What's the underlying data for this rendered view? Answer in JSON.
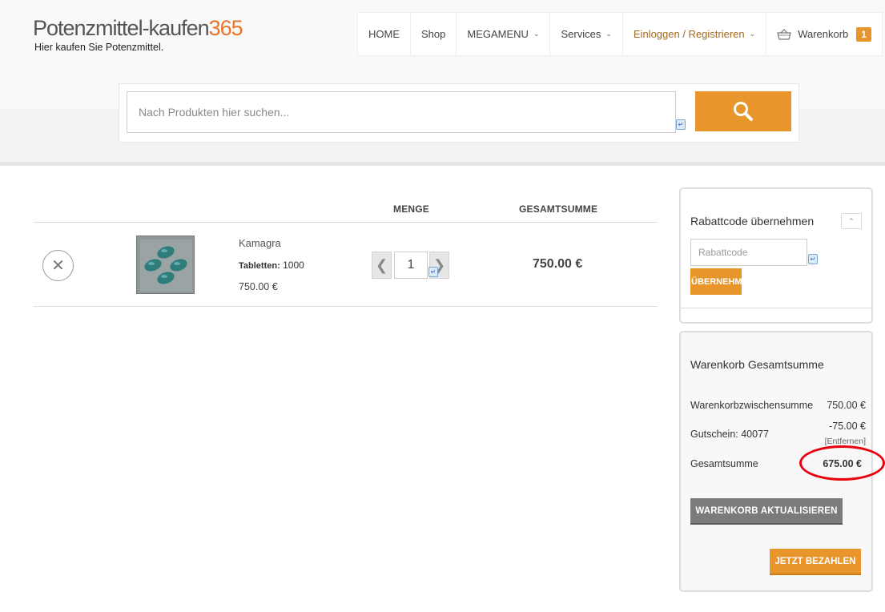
{
  "site": {
    "logo_text": "Potenzmittel-kaufen",
    "logo_number": "365",
    "tagline": "Hier kaufen Sie Potenzmittel."
  },
  "nav": {
    "home": "HOME",
    "shop": "Shop",
    "megamenu": "MEGAMENU",
    "services": "Services",
    "login": "Einloggen / Registrieren",
    "cart": "Warenkorb",
    "cart_count": "1"
  },
  "search": {
    "placeholder": "Nach Produkten hier suchen..."
  },
  "cart_table": {
    "headers": {
      "quantity": "MENGE",
      "total": "GESAMTSUMME"
    },
    "items": [
      {
        "name": "Kamagra",
        "variant_label": "Tabletten:",
        "variant_value": "1000",
        "unit_price": "750.00 €",
        "quantity": "1",
        "line_total": "750.00 €"
      }
    ]
  },
  "coupon": {
    "title": "Rabattcode übernehmen",
    "placeholder": "Rabattcode",
    "apply_label": "ÜBERNEHMEN"
  },
  "totals": {
    "title": "Warenkorb Gesamtsumme",
    "subtotal_label": "Warenkorbzwischensumme",
    "subtotal_value": "750.00 €",
    "coupon_label": "Gutschein: 40077",
    "coupon_value": "-75.00 €",
    "coupon_remove": "[Entfernen]",
    "grand_label": "Gesamtsumme",
    "grand_value": "675.00 €",
    "update_label": "WARENKORB AKTUALISIEREN",
    "pay_label": "JETZT BEZAHLEN"
  },
  "colors": {
    "accent_orange": "#e8952c",
    "logo_orange": "#e8742a",
    "highlight_red": "#e8000c",
    "update_gray": "#7b7b7b"
  }
}
